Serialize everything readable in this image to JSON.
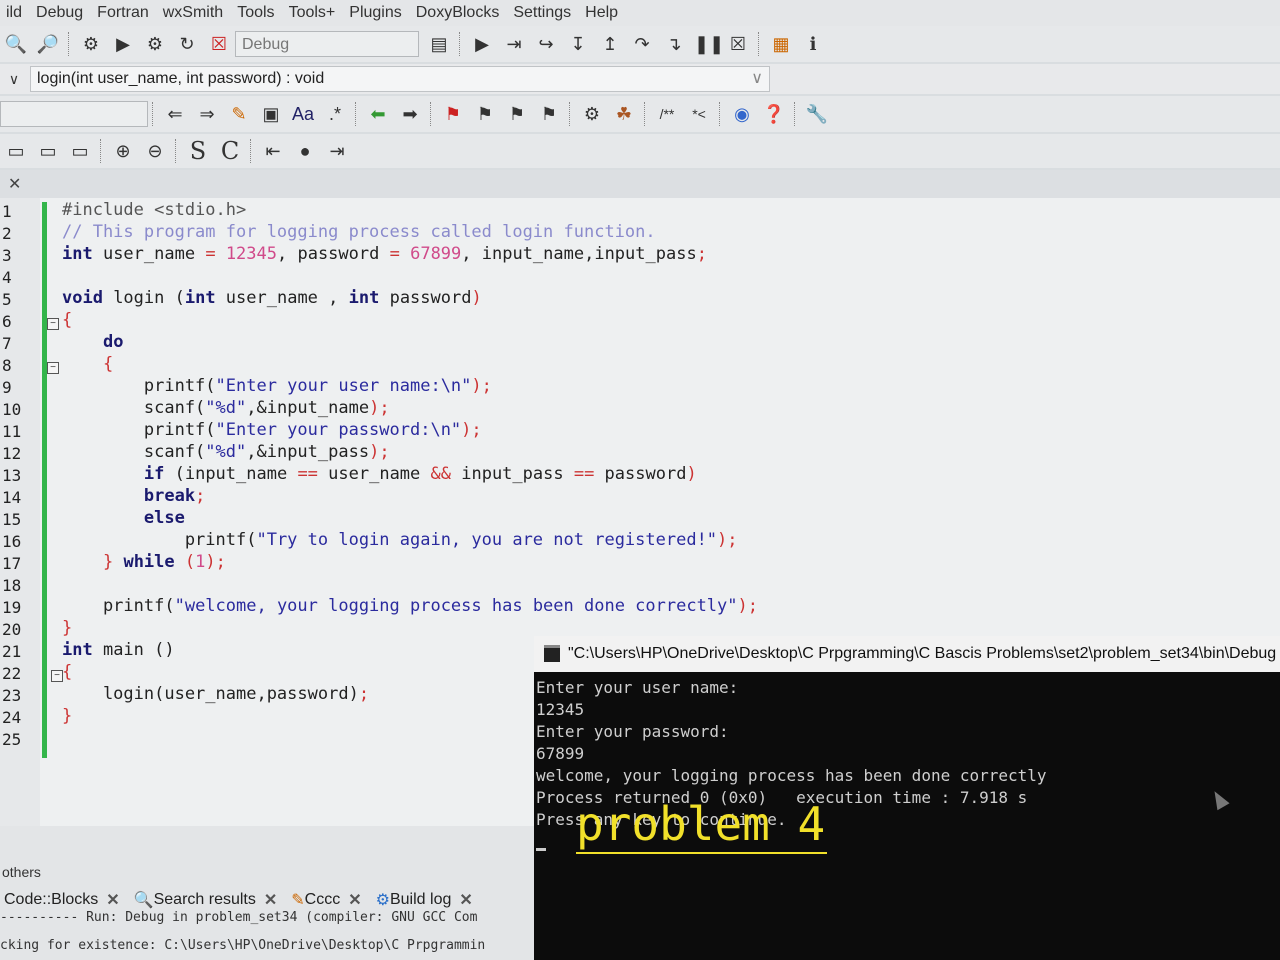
{
  "menu": [
    "ild",
    "Debug",
    "Fortran",
    "wxSmith",
    "Tools",
    "Tools+",
    "Plugins",
    "DoxyBlocks",
    "Settings",
    "Help"
  ],
  "toolbar": {
    "build_target": "Debug"
  },
  "code_nav": {
    "function_signature": "login(int user_name, int password) : void"
  },
  "toolbar3": {
    "font_label": "Aa",
    "regex_label": ".*"
  },
  "toolbar4": {
    "s_label": "S",
    "c_label": "C"
  },
  "editor": {
    "line_numbers": [
      "1",
      "2",
      "3",
      "4",
      "5",
      "6",
      "7",
      "8",
      "9",
      "10",
      "11",
      "12",
      "13",
      "14",
      "15",
      "16",
      "17",
      "18",
      "19",
      "20",
      "21",
      "22",
      "23",
      "24",
      "25"
    ]
  },
  "bottom_panel": {
    "title": "others",
    "tabs": [
      "Code::Blocks",
      "Search results",
      "Cccc",
      "Build log"
    ],
    "log_lines": [
      "---------- Run: Debug in problem_set34 (compiler: GNU GCC Com",
      "cking for existence: C:\\Users\\HP\\OneDrive\\Desktop\\C Prpgrammin"
    ]
  },
  "console": {
    "title": "\"C:\\Users\\HP\\OneDrive\\Desktop\\C Prpgramming\\C Bascis Problems\\set2\\problem_set34\\bin\\Debug",
    "lines": [
      "Enter your user name:",
      "12345",
      "Enter your password:",
      "67899",
      "welcome, your logging process has been done correctly",
      "Process returned 0 (0x0)   execution time : 7.918 s",
      "Press any key to continue."
    ]
  },
  "overlay_text": "problem 4"
}
